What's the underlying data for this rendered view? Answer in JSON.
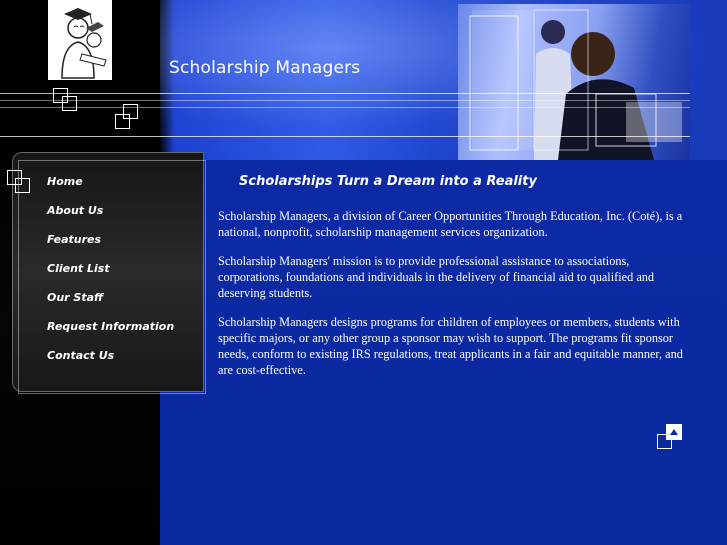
{
  "header": {
    "site_title": "Scholarship Managers"
  },
  "nav": {
    "items": [
      {
        "label": "Home"
      },
      {
        "label": "About Us"
      },
      {
        "label": "Features"
      },
      {
        "label": "Client List"
      },
      {
        "label": "Our Staff"
      },
      {
        "label": "Request Information"
      },
      {
        "label": "Contact Us"
      }
    ]
  },
  "content": {
    "heading": "Scholarships Turn a Dream into a Reality",
    "paragraphs": [
      "Scholarship Managers, a division of Career Opportunities Through Education, Inc. (Coté), is a national, nonprofit, scholarship management services organization.",
      "Scholarship Managers' mission is to provide professional assistance to associations, corporations, foundations and individuals in the delivery of financial aid to qualified and deserving students.",
      "Scholarship Managers designs programs for children of employees or members, students with specific majors, or any other group a sponsor may wish to support.  The programs fit sponsor needs, conform to existing IRS regulations, treat applicants in a fair and equitable manner, and are cost-effective."
    ]
  },
  "icons": {
    "logo": "graduate-with-diploma-logo",
    "back_to_top": "arrow-up-icon"
  },
  "colors": {
    "background": "#0a2a9e",
    "sidebar": "#000000",
    "text": "#ffffff"
  }
}
